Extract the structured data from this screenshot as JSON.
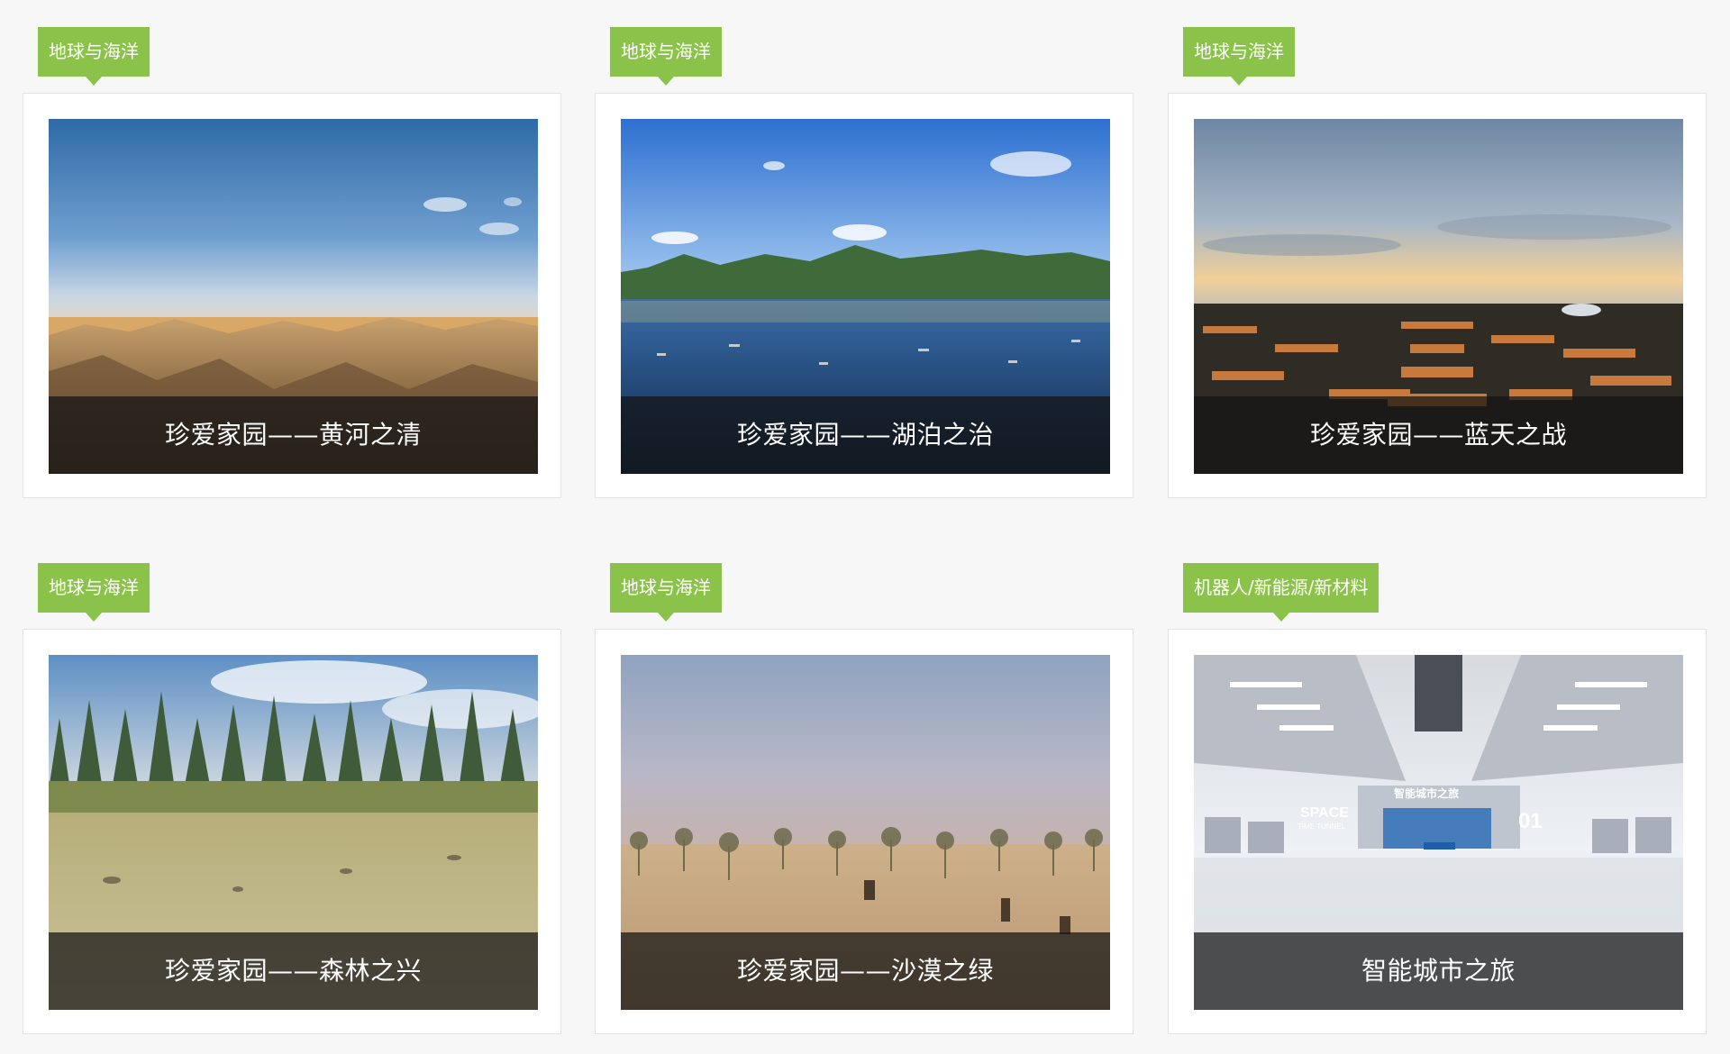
{
  "cards": [
    {
      "category": "地球与海洋",
      "title": "珍爱家园——黄河之清",
      "scene": "yellow-river"
    },
    {
      "category": "地球与海洋",
      "title": "珍爱家园——湖泊之治",
      "scene": "lake"
    },
    {
      "category": "地球与海洋",
      "title": "珍爱家园——蓝天之战",
      "scene": "forbidden-city"
    },
    {
      "category": "地球与海洋",
      "title": "珍爱家园——森林之兴",
      "scene": "forest"
    },
    {
      "category": "地球与海洋",
      "title": "珍爱家园——沙漠之绿",
      "scene": "desert"
    },
    {
      "category": "机器人/新能源/新材料",
      "title": "智能城市之旅",
      "scene": "space-tunnel",
      "scene_text": [
        "SPACE",
        "TIME TUNNEL",
        "智能城市之旅",
        "01"
      ]
    }
  ],
  "colors": {
    "tag_green": "#8bc34a",
    "background": "#f7f7f7"
  }
}
